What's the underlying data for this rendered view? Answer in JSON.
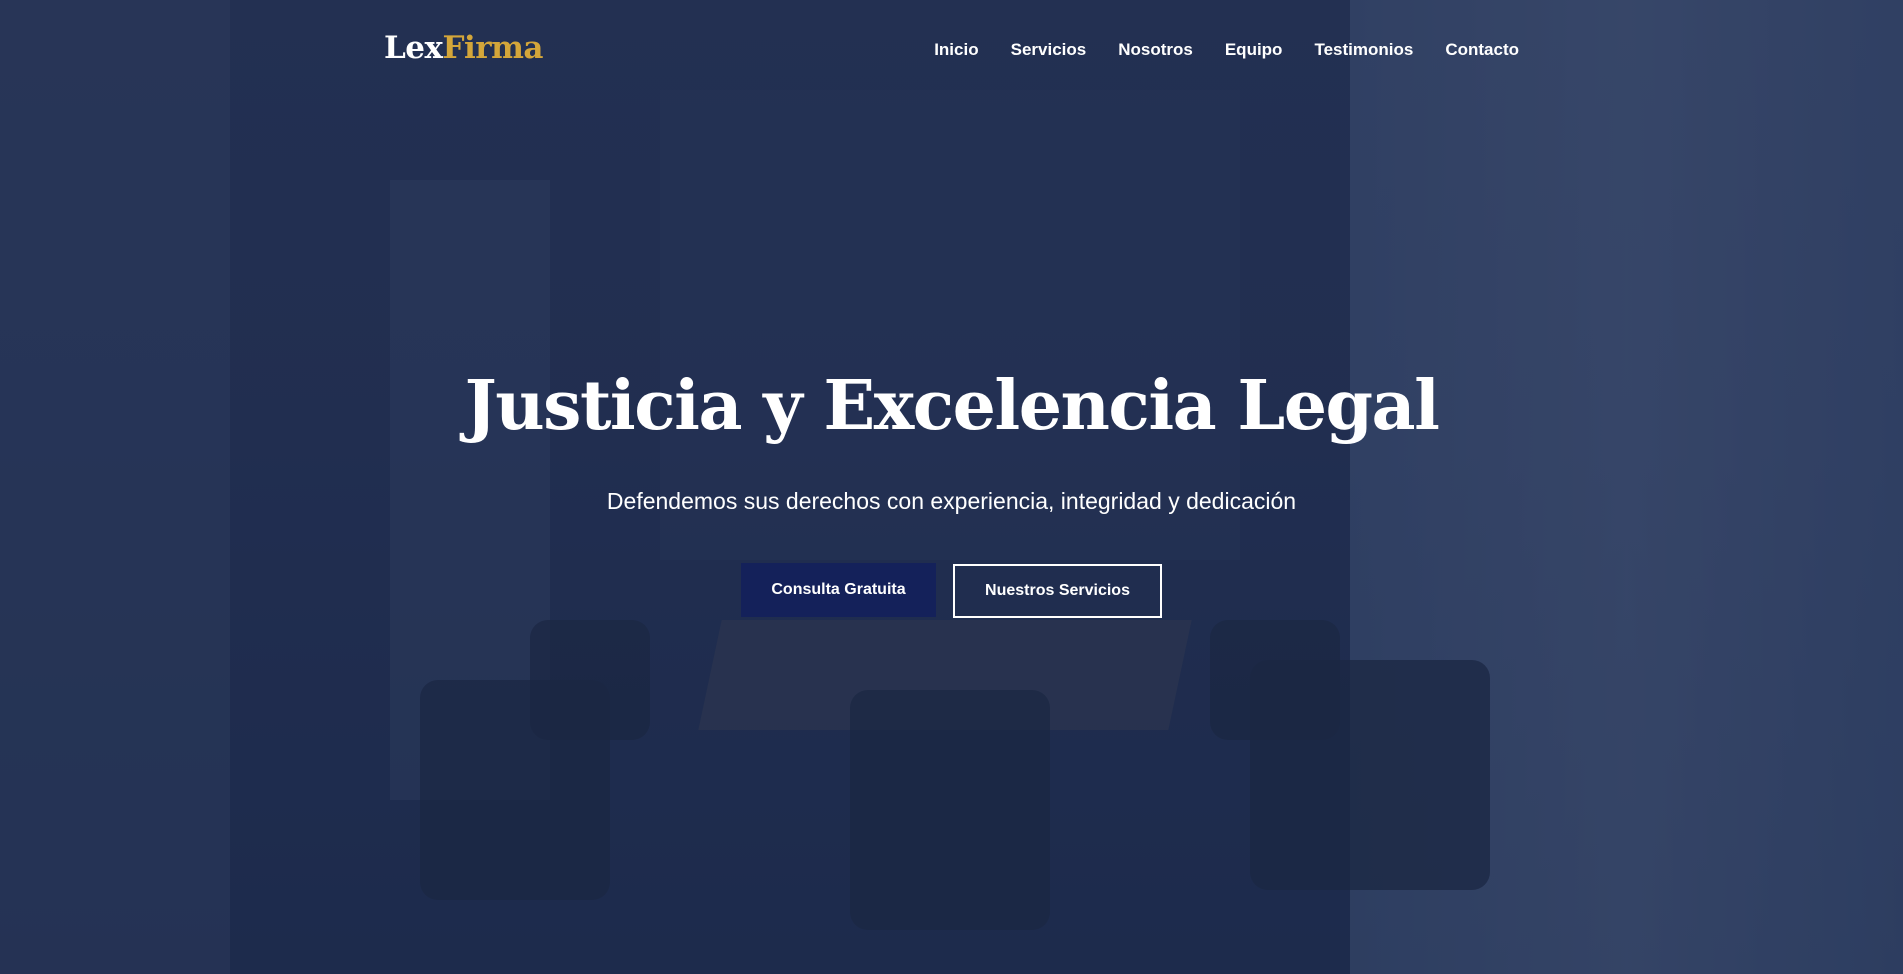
{
  "logo": {
    "part1": "Lex",
    "part2": "Firma"
  },
  "nav": {
    "items": [
      "Inicio",
      "Servicios",
      "Nosotros",
      "Equipo",
      "Testimonios",
      "Contacto"
    ]
  },
  "hero": {
    "title": "Justicia y Excelencia Legal",
    "subtitle": "Defendemos sus derechos con experiencia, integridad y dedicación",
    "primary_button": "Consulta Gratuita",
    "secondary_button": "Nuestros Servicios"
  },
  "colors": {
    "overlay": "#1a2a54",
    "accent": "#d4a63a",
    "primary_button": "#14215a"
  }
}
